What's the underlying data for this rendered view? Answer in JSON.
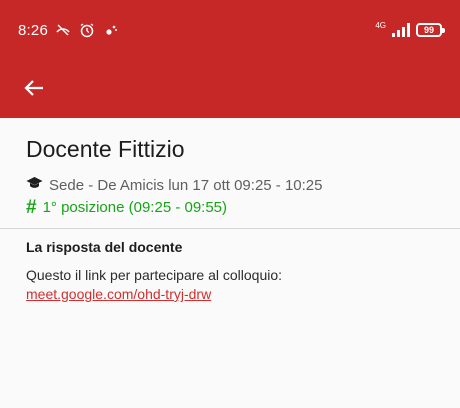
{
  "status_bar": {
    "time": "8:26",
    "icons": [
      "missed-call-icon",
      "alarm-icon",
      "settings-dots-icon"
    ],
    "network_label": "4G",
    "battery": "99"
  },
  "app_bar": {
    "back_icon": "arrow-left-icon"
  },
  "appointment": {
    "teacher_name": "Docente Fittizio",
    "meta_icon": "graduation-cap-icon",
    "meta": "Sede - De Amicis lun 17 ott 09:25 - 10:25",
    "position_symbol": "#",
    "position": "1° posizione (09:25 - 09:55)"
  },
  "response": {
    "title": "La risposta del docente",
    "body": "Questo il link per partecipare al colloquio:",
    "link": "meet.google.com/ohd-tryj-drw"
  },
  "colors": {
    "primary": "#c62828",
    "success": "#18a418",
    "link": "#d32f2f"
  }
}
